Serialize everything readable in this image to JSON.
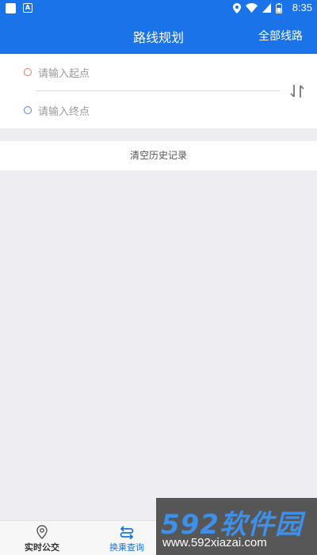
{
  "status_bar": {
    "time": "8:35",
    "left_icons": [
      "app-square-icon",
      "android-a-icon"
    ],
    "right_icons": [
      "location-icon",
      "wifi-icon",
      "signal-icon",
      "battery-icon"
    ]
  },
  "header": {
    "title": "路线规划",
    "right_action": "全部线路",
    "color": "#1a73e8"
  },
  "route_input": {
    "start_placeholder": "请输入起点",
    "end_placeholder": "请输入终点",
    "start_dot_color": "#e07a5f",
    "end_dot_color": "#5b7fd6",
    "swap_icon": "swap-vertical-icon"
  },
  "history": {
    "clear_label": "清空历史记录"
  },
  "bottom_nav": {
    "items": [
      {
        "label": "实时公交",
        "icon": "location-pin-icon",
        "active": false
      },
      {
        "label": "换乘查询",
        "icon": "transfer-icon",
        "active": true
      }
    ]
  },
  "watermark": {
    "brand": "592软件园",
    "url": "www.592xiazai.com"
  }
}
